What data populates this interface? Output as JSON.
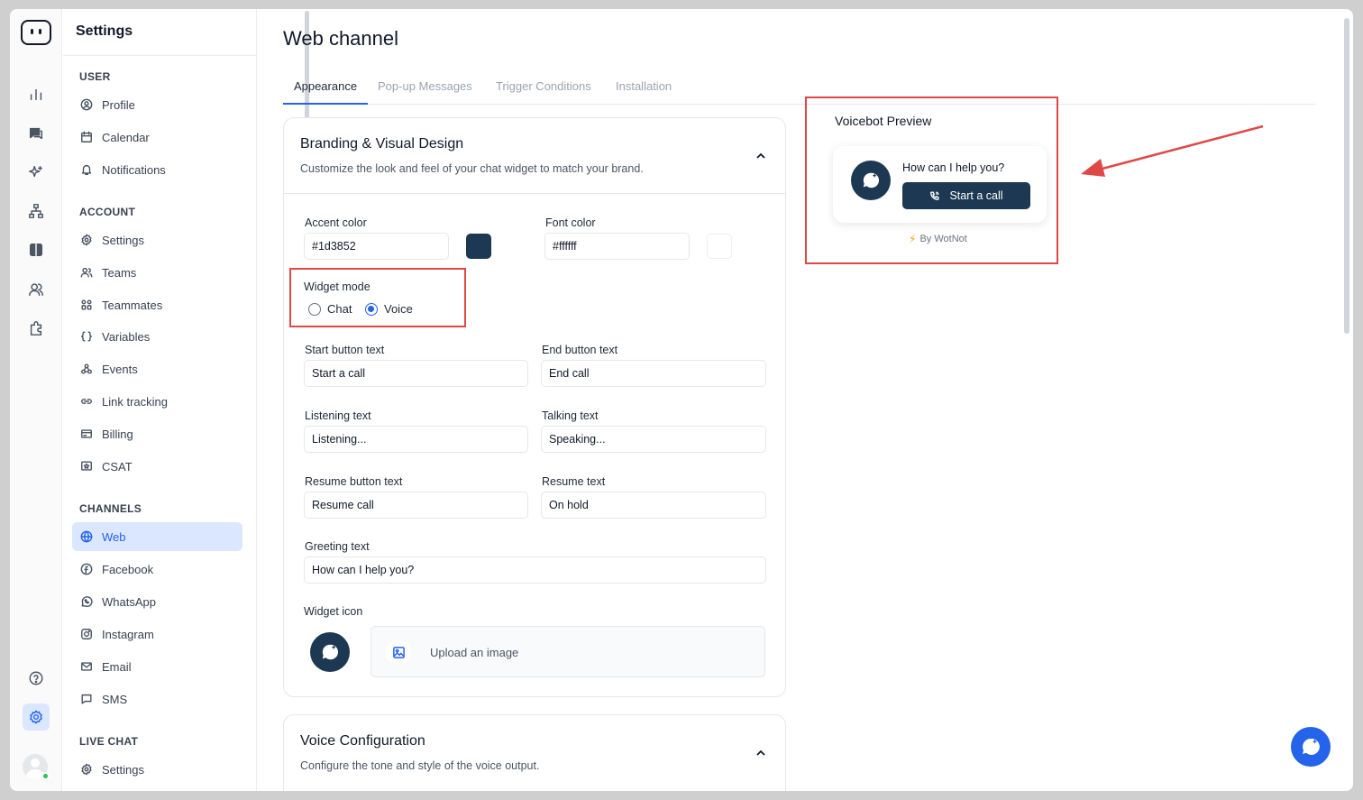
{
  "sidebar": {
    "title": "Settings",
    "sections": {
      "user": "USER",
      "account": "ACCOUNT",
      "channels": "CHANNELS",
      "live_chat": "LIVE CHAT"
    },
    "items": {
      "profile": "Profile",
      "calendar": "Calendar",
      "notifications": "Notifications",
      "settings": "Settings",
      "teams": "Teams",
      "teammates": "Teammates",
      "variables": "Variables",
      "events": "Events",
      "link_tracking": "Link tracking",
      "billing": "Billing",
      "csat": "CSAT",
      "web": "Web",
      "facebook": "Facebook",
      "whatsapp": "WhatsApp",
      "instagram": "Instagram",
      "email": "Email",
      "sms": "SMS",
      "live_settings": "Settings"
    }
  },
  "main": {
    "title": "Web channel",
    "tabs": [
      "Appearance",
      "Pop-up Messages",
      "Trigger Conditions",
      "Installation"
    ],
    "branding": {
      "title": "Branding & Visual Design",
      "subtitle": "Customize the look and feel of your chat widget to match your brand.",
      "accent_label": "Accent color",
      "accent_value": "#1d3852",
      "font_label": "Font color",
      "font_value": "#ffffff",
      "mode_label": "Widget mode",
      "mode_chat": "Chat",
      "mode_voice": "Voice",
      "start_label": "Start button text",
      "start_value": "Start a call",
      "end_label": "End button text",
      "end_value": "End call",
      "listening_label": "Listening text",
      "listening_value": "Listening...",
      "talking_label": "Talking text",
      "talking_value": "Speaking...",
      "resume_btn_label": "Resume button text",
      "resume_btn_value": "Resume call",
      "resume_label": "Resume text",
      "resume_value": "On hold",
      "greeting_label": "Greeting text",
      "greeting_value": "How can I help you?",
      "icon_label": "Widget icon",
      "upload_text": "Upload an image"
    },
    "voice": {
      "title": "Voice Configuration",
      "subtitle": "Configure the tone and style of the voice output."
    }
  },
  "preview": {
    "title": "Voicebot Preview",
    "greeting": "How can I help you?",
    "button": "Start a call",
    "powered": "By WotNot"
  },
  "colors": {
    "accent": "#1d3852",
    "font": "#ffffff",
    "primary": "#2563eb",
    "annotation": "#e04848"
  }
}
